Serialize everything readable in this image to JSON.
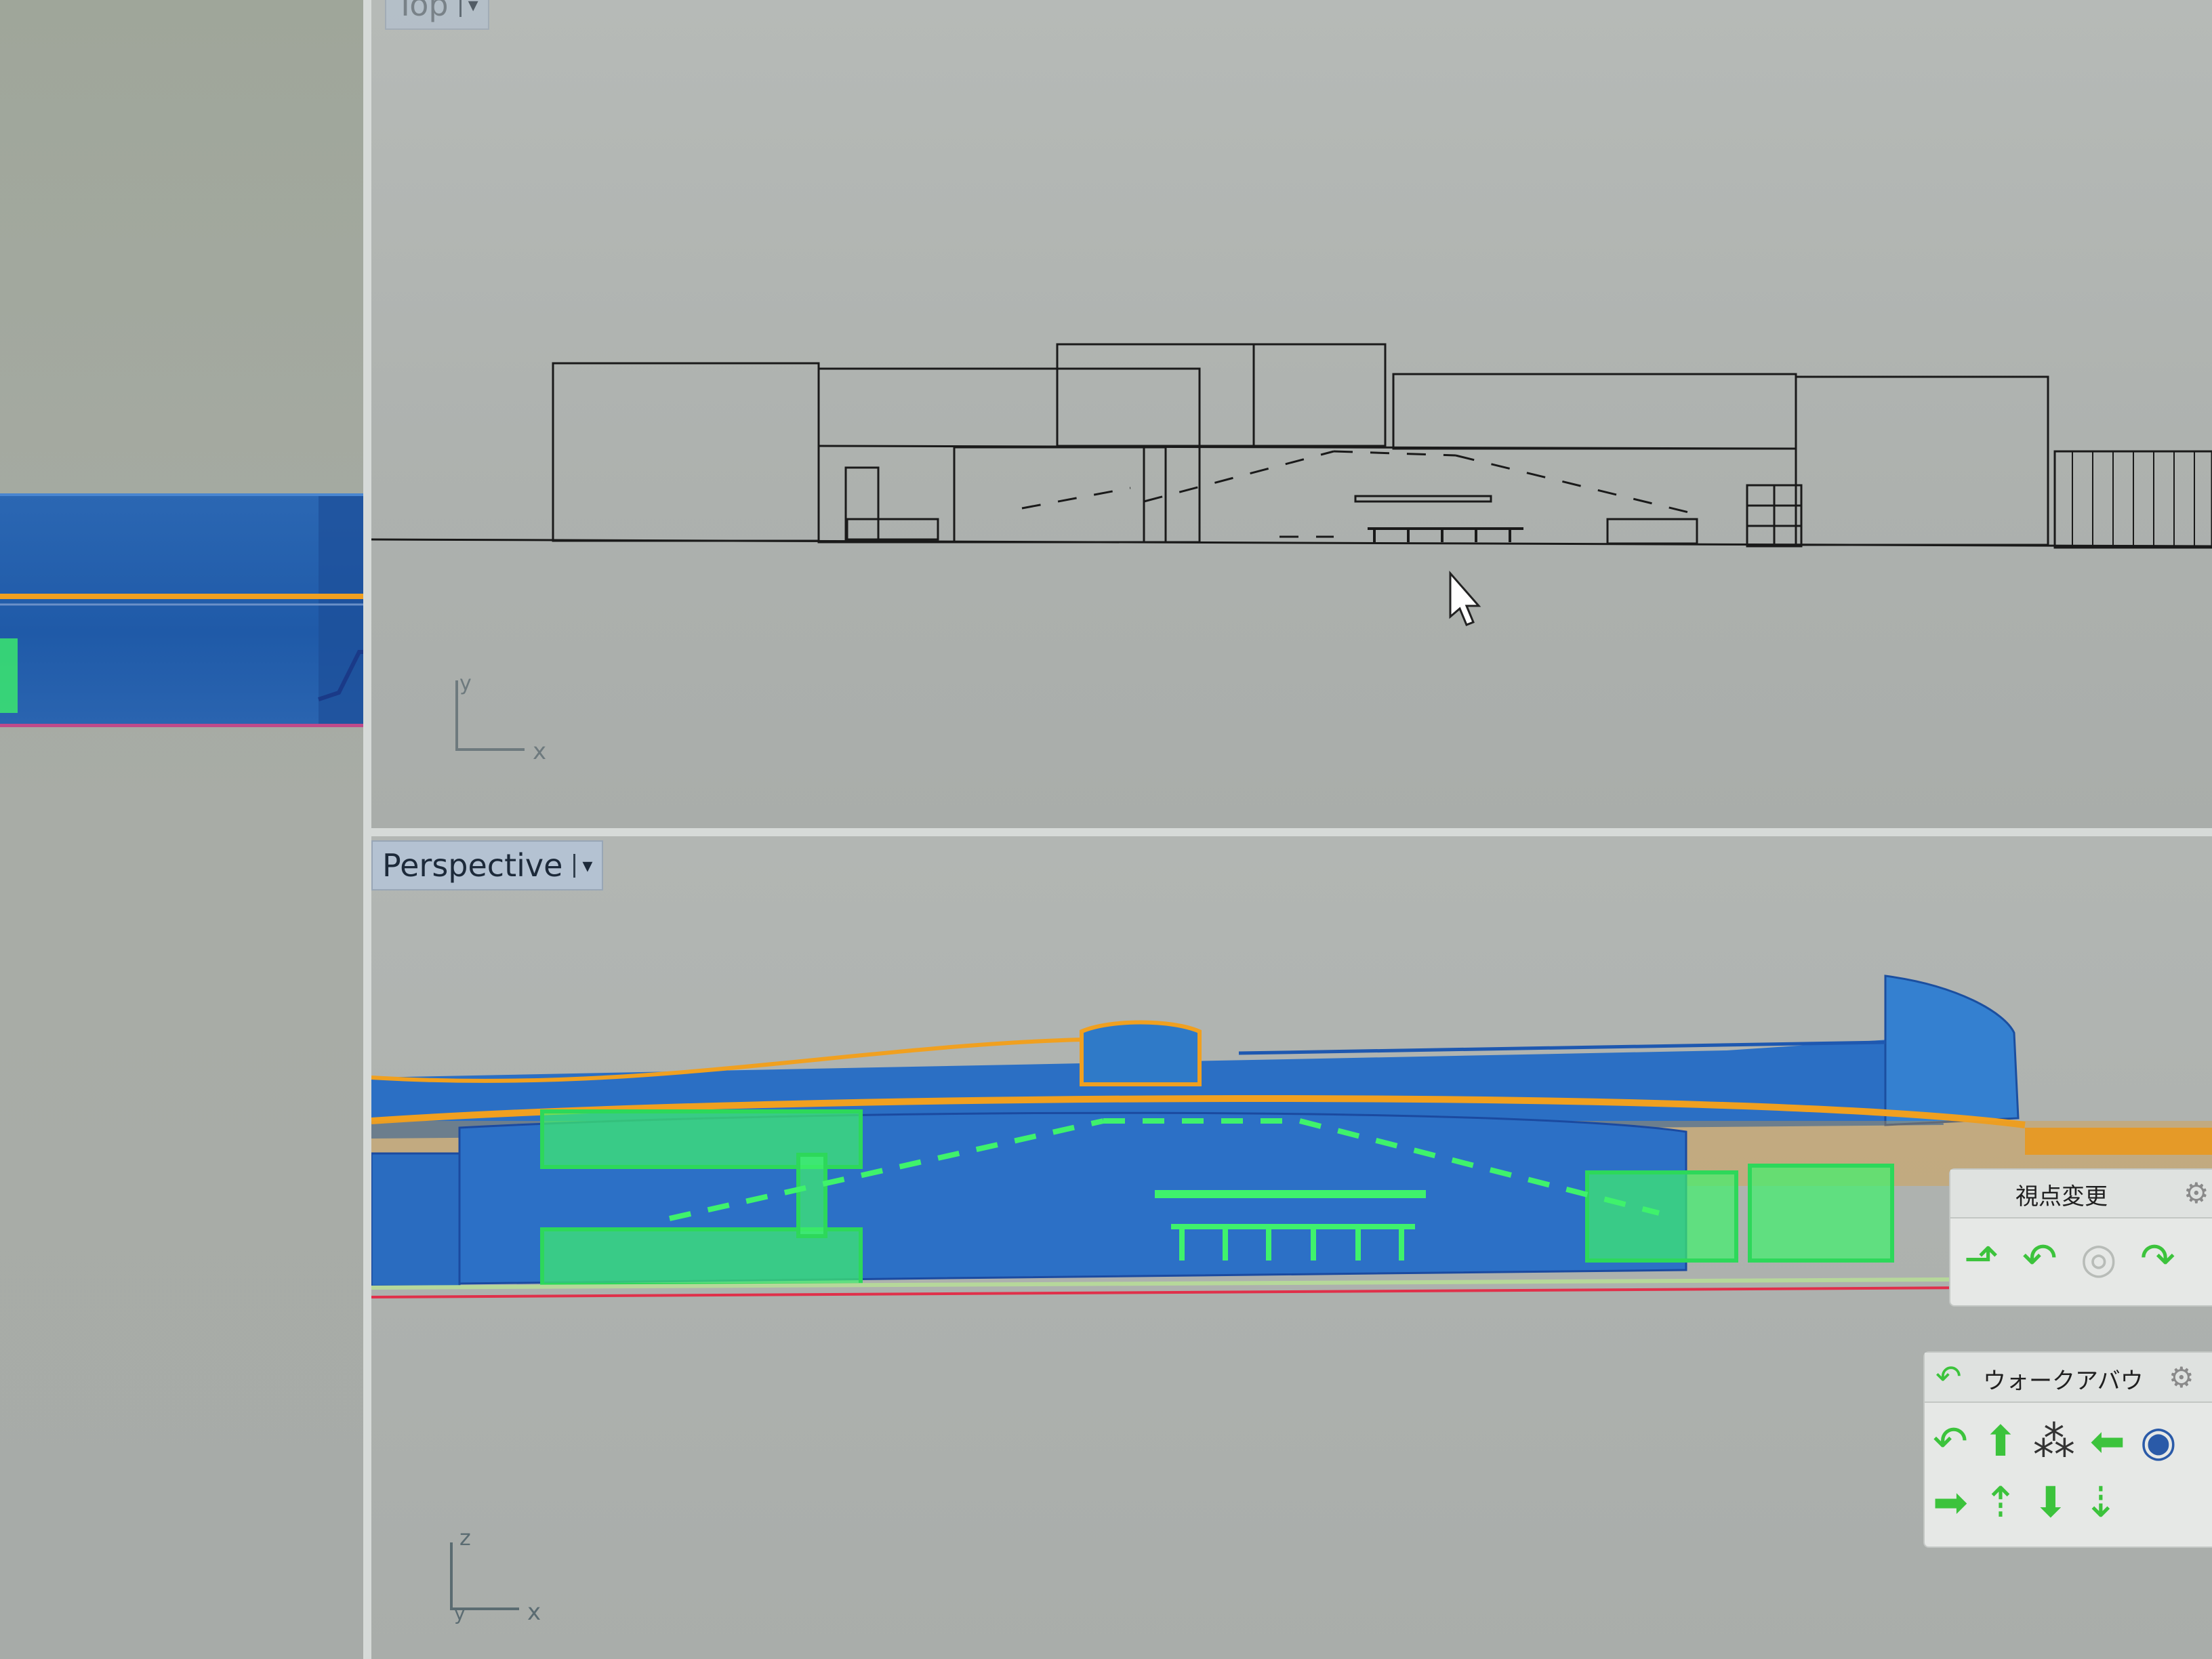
{
  "viewports": {
    "top": {
      "label": "Top",
      "axis_x": "x",
      "axis_y": "y"
    },
    "perspective": {
      "label": "Perspective",
      "axis_x": "x",
      "axis_y": "y",
      "axis_z": "z"
    }
  },
  "toolbars": {
    "view_change": {
      "title": "視点変更",
      "tools": [
        "rotate-up-icon",
        "rotate-left-icon",
        "orbit-target-icon",
        "rotate-right-icon"
      ]
    },
    "walkabout": {
      "title": "ウォークアバウ",
      "tools_row1": [
        "turn-left-icon",
        "walk-forward-icon",
        "footsteps-icon",
        "walk-left-icon",
        "camera-icon"
      ],
      "tools_row2": [
        "walk-right-icon",
        "person-up-icon",
        "walk-back-icon",
        "person-down-icon"
      ]
    }
  },
  "colors": {
    "wireframe": "#1a1a1a",
    "surface_blue": "#2a72c8",
    "selection_green": "#3cf06a",
    "outline_orange": "#f0a020",
    "ground_red": "#e0304a"
  }
}
